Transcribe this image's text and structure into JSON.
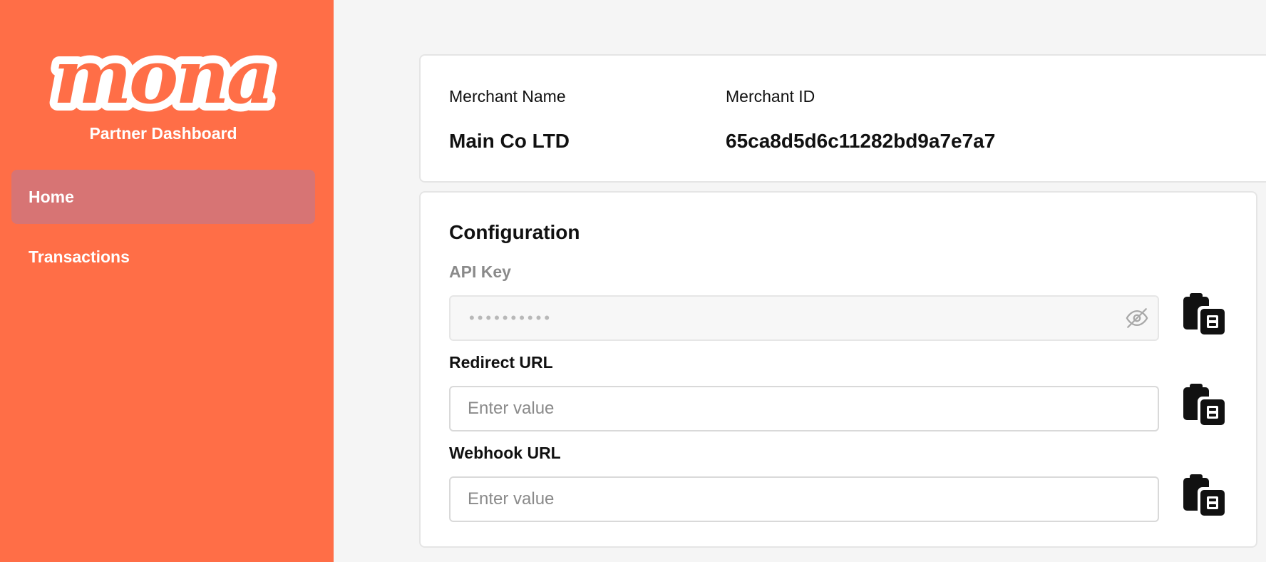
{
  "sidebar": {
    "logo_text": "mona",
    "subtitle": "Partner Dashboard",
    "items": [
      {
        "label": "Home",
        "active": true
      },
      {
        "label": "Transactions",
        "active": false
      }
    ]
  },
  "merchant": {
    "name_label": "Merchant Name",
    "name_value": "Main Co LTD",
    "id_label": "Merchant ID",
    "id_value": "65ca8d5d6c11282bd9a7e7a7"
  },
  "configuration": {
    "title": "Configuration",
    "api_key": {
      "label": "API Key",
      "masked_value": "••••••••••",
      "visibility_icon": "eye-off-icon",
      "copy_icon": "clipboard-copy-icon"
    },
    "redirect_url": {
      "label": "Redirect URL",
      "value": "",
      "placeholder": "Enter value",
      "copy_icon": "clipboard-copy-icon"
    },
    "webhook_url": {
      "label": "Webhook URL",
      "value": "",
      "placeholder": "Enter value",
      "copy_icon": "clipboard-copy-icon"
    }
  },
  "colors": {
    "sidebar_bg": "#ff6e47",
    "nav_active_bg": "#d77474",
    "page_bg": "#f5f5f5",
    "card_bg": "#ffffff",
    "text": "#111111",
    "muted": "#8a8a8a"
  }
}
